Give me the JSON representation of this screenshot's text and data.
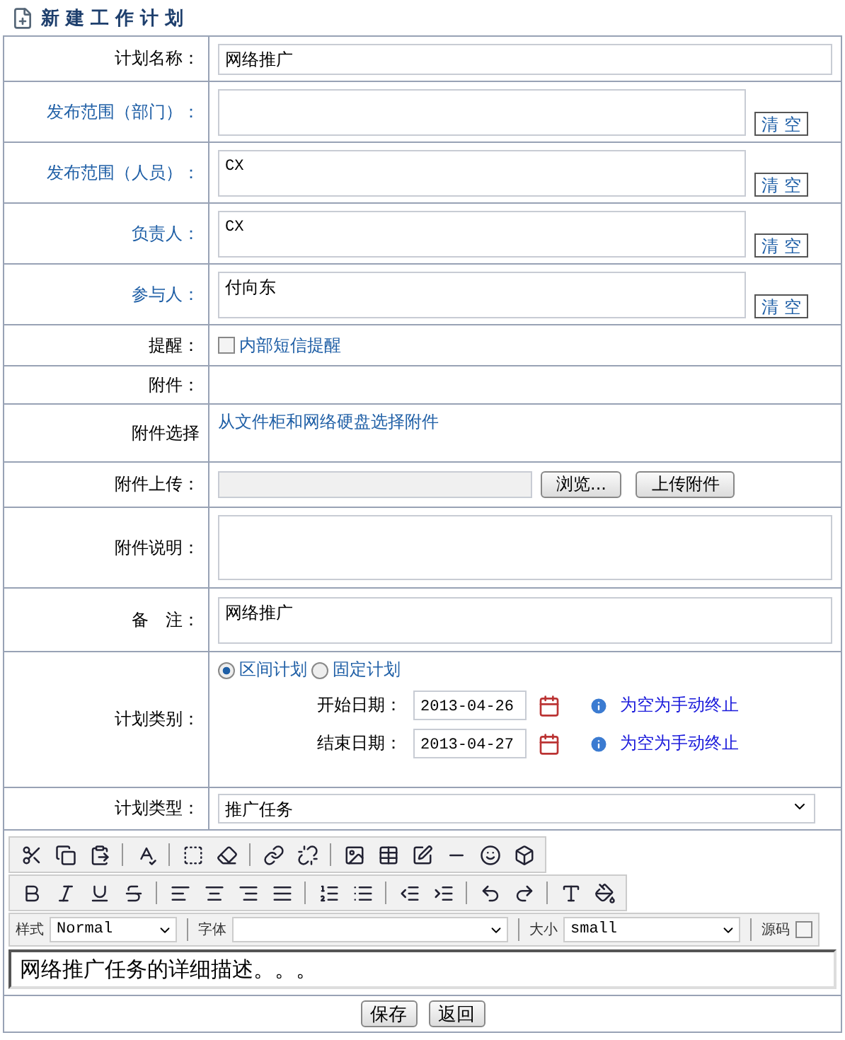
{
  "title": "新 建 工 作 计 划",
  "rows": [
    {
      "kind": "text",
      "label": "计划名称：",
      "color": "#000000",
      "value": "网络推广"
    },
    {
      "kind": "picker",
      "label": "发布范围（部门）：",
      "color": "#1f5fa6",
      "value": "",
      "button": "清 空"
    },
    {
      "kind": "picker",
      "label": "发布范围（人员）：",
      "color": "#1f5fa6",
      "value": "CX",
      "button": "清 空"
    },
    {
      "kind": "picker",
      "label": "负责人：",
      "color": "#1f5fa6",
      "value": "CX",
      "button": "清 空"
    },
    {
      "kind": "picker",
      "label": "参与人：",
      "color": "#1f5fa6",
      "value": "付向东",
      "button": "清 空"
    },
    {
      "kind": "checkbox",
      "label": "提醒：",
      "color": "#000000",
      "option": "内部短信提醒",
      "checked": false
    },
    {
      "kind": "empty",
      "label": "附件：",
      "color": "#000000"
    },
    {
      "kind": "link",
      "label": "附件选择",
      "color": "#000000",
      "link": "从文件柜和网络硬盘选择附件"
    },
    {
      "kind": "upload",
      "label": "附件上传：",
      "color": "#000000",
      "browse": "浏览...",
      "upload": "上传附件"
    },
    {
      "kind": "textarea",
      "label": "附件说明：",
      "color": "#000000"
    },
    {
      "kind": "memo",
      "label": "备　注：",
      "color": "#000000",
      "value": "网络推广"
    },
    {
      "kind": "category",
      "label": "计划类别：",
      "color": "#000000",
      "options": [
        {
          "label": "区间计划",
          "selected": true
        },
        {
          "label": "固定计划",
          "selected": false
        }
      ],
      "dates": [
        {
          "label": "开始日期：",
          "value": "2013-04-26",
          "hint": "为空为手动终止"
        },
        {
          "label": "结束日期：",
          "value": "2013-04-27",
          "hint": "为空为手动终止"
        }
      ]
    },
    {
      "kind": "select",
      "label": "计划类型：",
      "color": "#000000",
      "value": "推广任务"
    }
  ],
  "editor": {
    "selects": [
      {
        "label": "样式",
        "value": "Normal"
      },
      {
        "label": "字体"
      },
      {
        "label": "大小",
        "value": "small"
      }
    ],
    "source": {
      "label": "源码",
      "checked": false
    },
    "content": "网络推广任务的详细描述。。。"
  },
  "buttons": [
    "保存",
    "返回"
  ]
}
